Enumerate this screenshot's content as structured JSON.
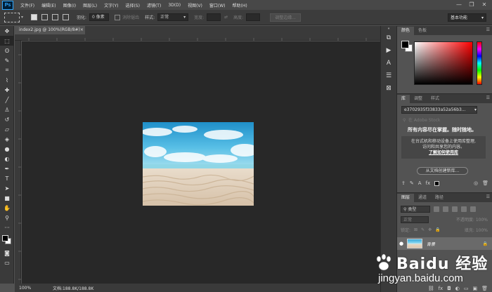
{
  "app": {
    "logo": "Ps",
    "menu": [
      "文件(F)",
      "编辑(E)",
      "图像(I)",
      "图层(L)",
      "文字(Y)",
      "选择(S)",
      "滤镜(T)",
      "3D(D)",
      "视图(V)",
      "窗口(W)",
      "帮助(H)"
    ],
    "window_controls": [
      "—",
      "❐",
      "✕"
    ]
  },
  "options": {
    "feather_label": "羽化:",
    "feather_value": "0 像素",
    "antialias_label": "消除锯齿",
    "style_label": "样式:",
    "style_value": "正常",
    "width_label": "宽度:",
    "height_label": "高度:",
    "refine_edge": "调整边缘...",
    "workspace": "基本功能"
  },
  "document": {
    "tab_title": "index2.jpg @ 100%(RGB/8#)",
    "tab_close": "×",
    "zoom": "100%",
    "doc_info": "文档:188.8K/188.8K"
  },
  "tools": [
    {
      "icon": "move-icon",
      "glyph": "✥"
    },
    {
      "icon": "marquee-icon",
      "glyph": "⬚"
    },
    {
      "icon": "lasso-icon",
      "glyph": "ʘ"
    },
    {
      "icon": "quick-select-icon",
      "glyph": "✎"
    },
    {
      "icon": "crop-icon",
      "glyph": "⌗"
    },
    {
      "icon": "eyedropper-icon",
      "glyph": "⌇"
    },
    {
      "icon": "healing-icon",
      "glyph": "✚"
    },
    {
      "icon": "brush-icon",
      "glyph": "╱"
    },
    {
      "icon": "stamp-icon",
      "glyph": "♙"
    },
    {
      "icon": "history-brush-icon",
      "glyph": "↺"
    },
    {
      "icon": "eraser-icon",
      "glyph": "▱"
    },
    {
      "icon": "paint-bucket-icon",
      "glyph": "◈"
    },
    {
      "icon": "blur-icon",
      "glyph": "●"
    },
    {
      "icon": "dodge-icon",
      "glyph": "◐"
    },
    {
      "icon": "pen-icon",
      "glyph": "✒"
    },
    {
      "icon": "type-icon",
      "glyph": "T"
    },
    {
      "icon": "path-select-icon",
      "glyph": "➤"
    },
    {
      "icon": "rectangle-icon",
      "glyph": "■"
    },
    {
      "icon": "hand-icon",
      "glyph": "✋"
    },
    {
      "icon": "zoom-icon",
      "glyph": "⚲"
    },
    {
      "icon": "more-tools-icon",
      "glyph": "···"
    }
  ],
  "color_panel": {
    "tabs": [
      "颜色",
      "色板"
    ],
    "foreground": "#000000",
    "background": "#ffffff"
  },
  "library_panel": {
    "tabs": [
      "库",
      "调整",
      "样式"
    ],
    "library_name": "e3702935f33833a52a56b3...",
    "search_placeholder": "在 Adobe Stock",
    "headline": "所有内容尽在掌握。随时随地。",
    "card_line1": "在台式机和移动设备上使用库整理,",
    "card_line2": "访问和共享您的内容。",
    "card_link": "了解如何使用库",
    "create_button": "从文档创建新库..."
  },
  "layers_panel": {
    "tabs": [
      "图层",
      "通道",
      "路径"
    ],
    "filter_label": "类型",
    "blend_mode": "正常",
    "opacity_label": "不透明度:",
    "opacity_value": "100%",
    "lock_label": "锁定:",
    "fill_label": "填充:",
    "fill_value": "100%",
    "layer_name": "背景"
  },
  "watermark": {
    "brand": "Baidu 经验",
    "url": "jingyan.baidu.com"
  }
}
